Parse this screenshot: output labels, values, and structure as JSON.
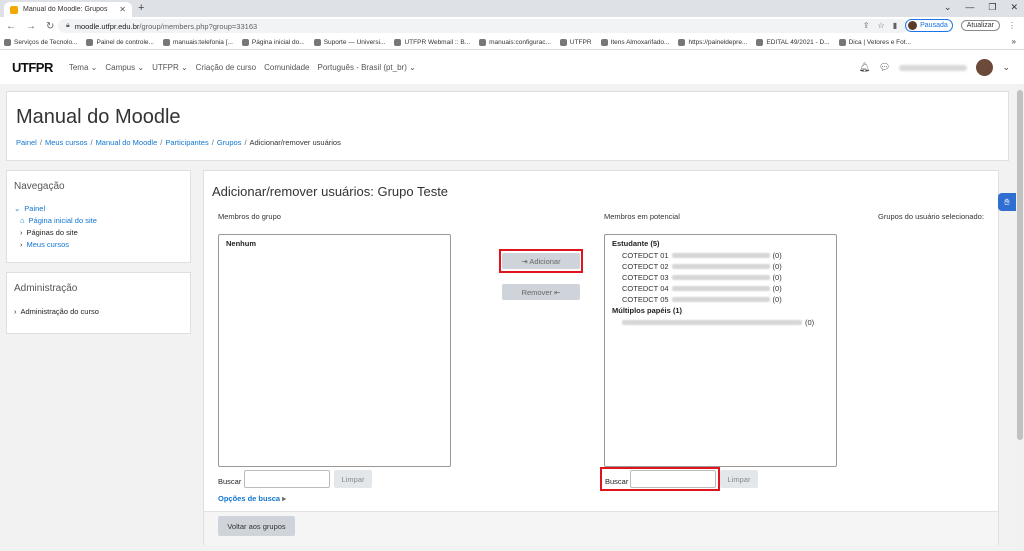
{
  "browser": {
    "tab_title": "Manual do Moodle: Grupos",
    "url_host": "moodle.utfpr.edu.br",
    "url_path": "/group/members.php?group=33163",
    "profile_label": "Pausada",
    "update_label": "Atualizar",
    "bookmarks": [
      "Serviços de Tecnolo...",
      "Painel de controle...",
      "manuais:telefonia [...",
      "Página inicial do...",
      "Suporte — Universi...",
      "UTFPR Webmail :: B...",
      "manuais:configurac...",
      "UTFPR",
      "Itens Almoxarifado...",
      "https://paineldepre...",
      "EDITAL 49/2021 - D...",
      "Dica | Vetores e Fot..."
    ]
  },
  "navbar": {
    "logo": "UTFPR",
    "items": [
      "Tema ⌄",
      "Campus ⌄",
      "UTFPR ⌄",
      "Criação de curso",
      "Comunidade",
      "Português - Brasil (pt_br) ⌄"
    ]
  },
  "header": {
    "course_title": "Manual do Moodle",
    "breadcrumb": [
      "Painel",
      "Meus cursos",
      "Manual do Moodle",
      "Participantes",
      "Grupos",
      "Adicionar/remover usuários"
    ]
  },
  "navigation": {
    "title": "Navegação",
    "root": "Painel",
    "items": [
      "Página inicial do site",
      "Páginas do site",
      "Meus cursos"
    ]
  },
  "administration": {
    "title": "Administração",
    "items": [
      "Administração do curso"
    ]
  },
  "main": {
    "title": "Adicionar/remover usuários: Grupo Teste",
    "members_label": "Membros do grupo",
    "potential_label": "Membros em potencial",
    "selected_groups_label": "Grupos do usuário selecionado:",
    "members_empty": "Nenhum",
    "add_button": "⇥ Adicionar",
    "remove_button": "Remover ⇤",
    "search_label": "Buscar",
    "clear_label": "Limpar",
    "search_options": "Opções de busca",
    "back_button": "Voltar aos grupos",
    "potential": {
      "group1": "Estudante (5)",
      "students": [
        {
          "name": "COTEDCT 01",
          "count": "(0)"
        },
        {
          "name": "COTEDCT 02",
          "count": "(0)"
        },
        {
          "name": "COTEDCT 03",
          "count": "(0)"
        },
        {
          "name": "COTEDCT 04",
          "count": "(0)"
        },
        {
          "name": "COTEDCT 05",
          "count": "(0)"
        }
      ],
      "group2": "Múltiplos papéis (1)",
      "multi_count": "(0)"
    }
  }
}
